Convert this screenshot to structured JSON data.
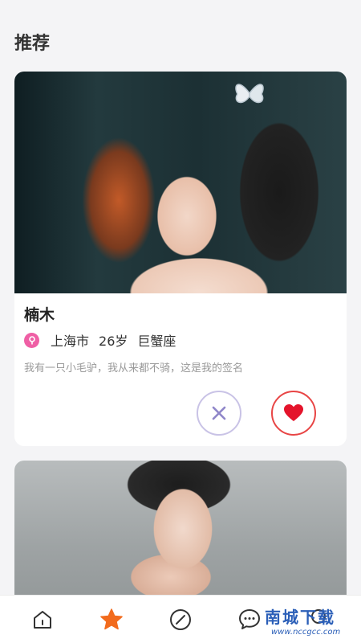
{
  "page": {
    "title": "推荐"
  },
  "profiles": [
    {
      "name": "楠木",
      "city": "上海市",
      "age": "26岁",
      "zodiac": "巨蟹座",
      "signature": "我有一只小毛驴，我从来都不骑，这是我的签名",
      "gender_icon": "female-icon"
    }
  ],
  "actions": {
    "dislike_icon": "close-icon",
    "like_icon": "heart-icon"
  },
  "tabbar": {
    "items": [
      {
        "icon": "home-icon",
        "active": false
      },
      {
        "icon": "star-icon",
        "active": true
      },
      {
        "icon": "compass-icon",
        "active": false
      },
      {
        "icon": "chat-icon",
        "active": false
      },
      {
        "icon": "profile-icon",
        "active": false
      }
    ]
  },
  "watermark": {
    "main": "南城下载",
    "sub": "www.nccgcc.com"
  },
  "colors": {
    "accent": "#f26b1d",
    "like": "#e84545",
    "dislike": "#8f86c9",
    "gender": "#ef5fa5"
  }
}
